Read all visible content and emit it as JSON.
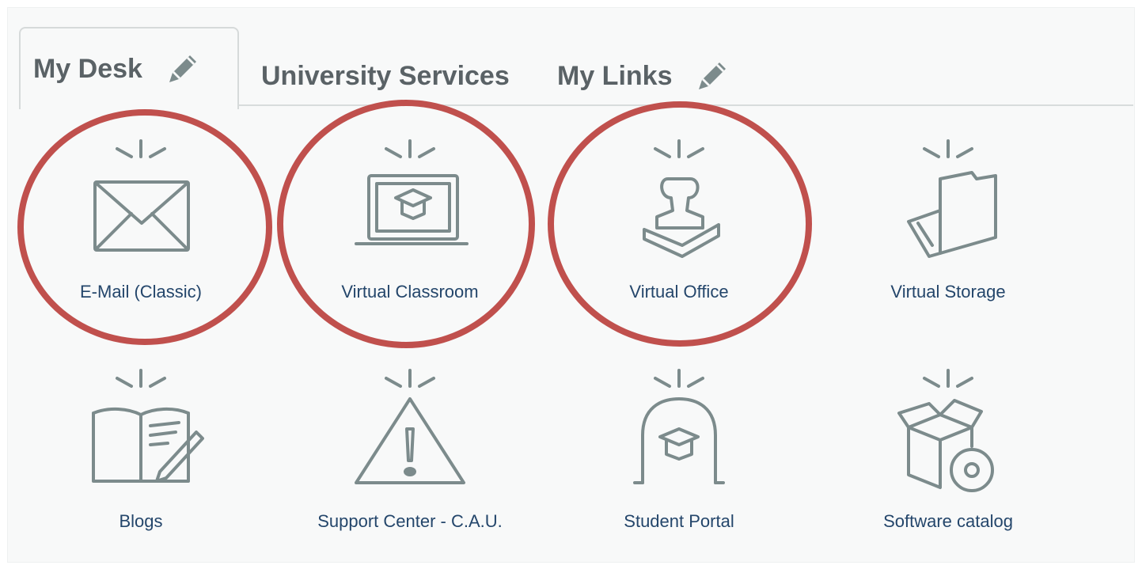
{
  "tabs": [
    {
      "label": "My Desk",
      "editable": true,
      "active": true
    },
    {
      "label": "University Services",
      "editable": false,
      "active": false
    },
    {
      "label": "My Links",
      "editable": true,
      "active": false
    }
  ],
  "tiles": [
    {
      "label": "E-Mail (Classic)",
      "icon": "envelope-icon",
      "highlighted": true
    },
    {
      "label": "Virtual Classroom",
      "icon": "laptop-graduation-cap-icon",
      "highlighted": true
    },
    {
      "label": "Virtual Office",
      "icon": "rubber-stamp-icon",
      "highlighted": true
    },
    {
      "label": "Virtual Storage",
      "icon": "folder-icon",
      "highlighted": false
    },
    {
      "label": "Blogs",
      "icon": "open-book-pen-icon",
      "highlighted": false
    },
    {
      "label": "Support Center - C.A.U.",
      "icon": "warning-triangle-icon",
      "highlighted": false
    },
    {
      "label": "Student Portal",
      "icon": "arch-graduation-cap-icon",
      "highlighted": false
    },
    {
      "label": "Software catalog",
      "icon": "software-box-disc-icon",
      "highlighted": false
    }
  ],
  "colors": {
    "tab_text": "#5a6266",
    "tile_label": "#24466b",
    "icon_stroke": "#7c8b8c",
    "highlight_ring": "#c0504d",
    "background": "#f8f9f9"
  }
}
